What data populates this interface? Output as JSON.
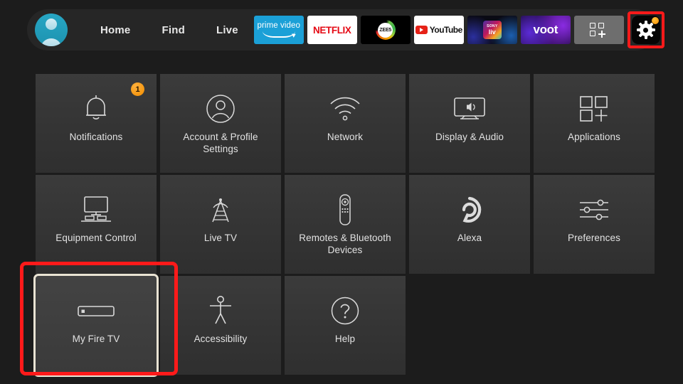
{
  "header": {
    "avatar_name": "profile-avatar",
    "nav": [
      {
        "label": "Home",
        "name": "nav-home"
      },
      {
        "label": "Find",
        "name": "nav-find"
      },
      {
        "label": "Live",
        "name": "nav-live"
      }
    ],
    "apps": [
      {
        "label": "prime video",
        "name": "app-prime-video"
      },
      {
        "label": "NETFLIX",
        "name": "app-netflix"
      },
      {
        "label": "ZEE5",
        "name": "app-zee5"
      },
      {
        "label": "YouTube",
        "name": "app-youtube"
      },
      {
        "label": "SONY LIV",
        "name": "app-sony-liv",
        "line1": "SONY",
        "line2": "liv"
      },
      {
        "label": "voot",
        "name": "app-voot"
      },
      {
        "label": "",
        "name": "app-grid-add"
      }
    ],
    "settings_gear": {
      "label": "Settings",
      "has_notification_dot": true,
      "highlighted": true,
      "highlight_color": "#ff1a1a"
    }
  },
  "settings_grid": {
    "rows": [
      [
        {
          "label": "Notifications",
          "icon": "bell-icon",
          "badge": "1"
        },
        {
          "label": "Account & Profile Settings",
          "icon": "person-circle-icon"
        },
        {
          "label": "Network",
          "icon": "wifi-icon"
        },
        {
          "label": "Display & Audio",
          "icon": "tv-audio-icon"
        },
        {
          "label": "Applications",
          "icon": "apps-grid-icon"
        }
      ],
      [
        {
          "label": "Equipment Control",
          "icon": "equipment-icon"
        },
        {
          "label": "Live TV",
          "icon": "antenna-icon"
        },
        {
          "label": "Remotes & Bluetooth Devices",
          "icon": "remote-icon"
        },
        {
          "label": "Alexa",
          "icon": "alexa-ring-icon"
        },
        {
          "label": "Preferences",
          "icon": "sliders-icon"
        }
      ],
      [
        {
          "label": "My Fire TV",
          "icon": "fire-tv-stick-icon",
          "focused": true,
          "highlighted": true
        },
        {
          "label": "Accessibility",
          "icon": "accessibility-icon"
        },
        {
          "label": "Help",
          "icon": "question-circle-icon"
        }
      ]
    ]
  },
  "colors": {
    "background": "#1c1c1c",
    "tile": "#3a3a3a",
    "accent_orange": "#f08c00",
    "highlight_red": "#ff1a1a",
    "focus_ring": "#e9e3d3",
    "text": "#e2e2e2"
  }
}
